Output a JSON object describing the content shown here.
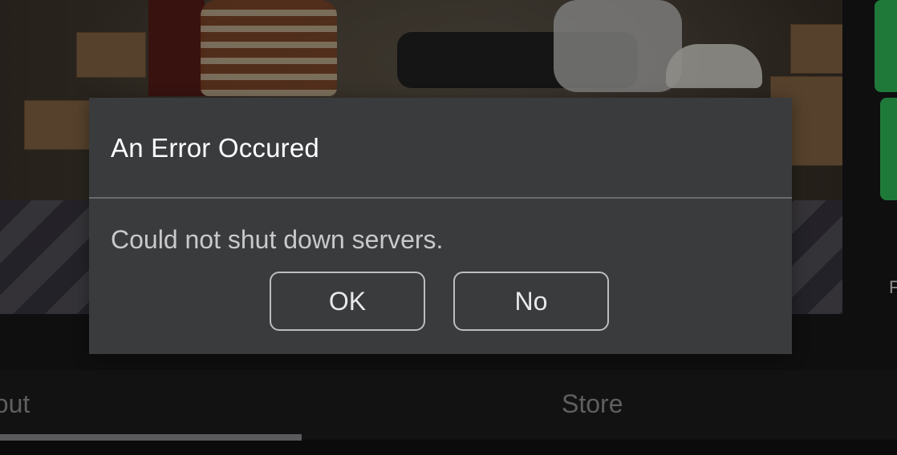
{
  "dialog": {
    "title": "An Error Occured",
    "message": "Could not shut down servers.",
    "buttons": {
      "ok_label": "OK",
      "no_label": "No"
    }
  },
  "tabs": [
    {
      "label": "bout"
    },
    {
      "label": "Store"
    }
  ],
  "right_edge_text": "F",
  "colors": {
    "dialog_background": "#3a3b3d",
    "title_text": "#ffffff",
    "message_text": "#c9c9cb",
    "button_border": "#bdbdbf",
    "tab_text": "#5f5f61",
    "accent_green": "#1f7a3a"
  }
}
